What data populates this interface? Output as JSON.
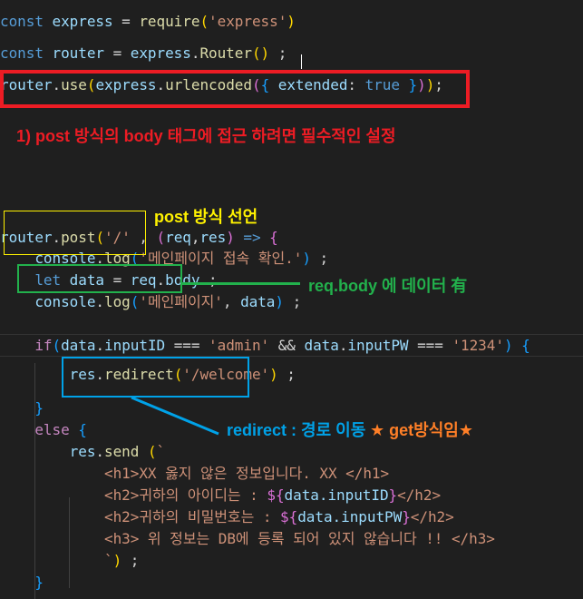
{
  "code_lines": [
    {
      "tokens": [
        [
          "const ",
          "kw"
        ],
        [
          "express",
          "var"
        ],
        [
          " = ",
          "pl"
        ],
        [
          "require",
          "fn"
        ],
        [
          "(",
          "b1"
        ],
        [
          "'express'",
          "str"
        ],
        [
          ")",
          "b1"
        ]
      ]
    },
    {
      "tokens": [
        [
          "const ",
          "kw"
        ],
        [
          "router",
          "var"
        ],
        [
          " = ",
          "pl"
        ],
        [
          "express",
          "var"
        ],
        [
          ".",
          "pl"
        ],
        [
          "Router",
          "fn"
        ],
        [
          "()",
          "b1"
        ],
        [
          " ;",
          "pl"
        ]
      ]
    },
    {
      "tokens": [
        [
          "router",
          "var"
        ],
        [
          ".",
          "pl"
        ],
        [
          "use",
          "fn"
        ],
        [
          "(",
          "b1"
        ],
        [
          "express",
          "var"
        ],
        [
          ".",
          "pl"
        ],
        [
          "urlencoded",
          "fn"
        ],
        [
          "(",
          "b2"
        ],
        [
          "{",
          "b3"
        ],
        [
          " extended",
          "var"
        ],
        [
          ": ",
          "pl"
        ],
        [
          "true",
          "kw"
        ],
        [
          " ",
          "pl"
        ],
        [
          "}",
          "b3"
        ],
        [
          ")",
          "b2"
        ],
        [
          ")",
          "b1"
        ],
        [
          ";",
          "pl"
        ]
      ]
    },
    {
      "tokens": [
        [
          "router",
          "var"
        ],
        [
          ".",
          "pl"
        ],
        [
          "post",
          "fn"
        ],
        [
          "(",
          "b1"
        ],
        [
          "'/'",
          "str"
        ],
        [
          " , ",
          "pl"
        ],
        [
          "(",
          "b2"
        ],
        [
          "req",
          "var"
        ],
        [
          ",",
          "pl"
        ],
        [
          "res",
          "var"
        ],
        [
          ")",
          "b2"
        ],
        [
          " ",
          "pl"
        ],
        [
          "=>",
          "kw"
        ],
        [
          " ",
          "pl"
        ],
        [
          "{",
          "b2"
        ]
      ]
    },
    {
      "tokens": [
        [
          "    console",
          "var"
        ],
        [
          ".",
          "pl"
        ],
        [
          "log",
          "fn"
        ],
        [
          "(",
          "b3"
        ],
        [
          "'메인페이지 접속 확인.'",
          "str"
        ],
        [
          ")",
          "b3"
        ],
        [
          " ;",
          "pl"
        ]
      ]
    },
    {
      "tokens": [
        [
          "    let ",
          "kw"
        ],
        [
          "data",
          "var"
        ],
        [
          " = ",
          "pl"
        ],
        [
          "req",
          "var"
        ],
        [
          ".",
          "pl"
        ],
        [
          "body",
          "var"
        ],
        [
          " ;",
          "pl"
        ]
      ]
    },
    {
      "tokens": [
        [
          "    console",
          "var"
        ],
        [
          ".",
          "pl"
        ],
        [
          "log",
          "fn"
        ],
        [
          "(",
          "b3"
        ],
        [
          "'메인페이지'",
          "str"
        ],
        [
          ", ",
          "pl"
        ],
        [
          "data",
          "var"
        ],
        [
          ")",
          "b3"
        ],
        [
          " ;",
          "pl"
        ]
      ]
    },
    {
      "tokens": []
    },
    {
      "tokens": [
        [
          "    if",
          "ctl"
        ],
        [
          "(",
          "b3"
        ],
        [
          "data",
          "var"
        ],
        [
          ".",
          "pl"
        ],
        [
          "inputID",
          "var"
        ],
        [
          " === ",
          "pl"
        ],
        [
          "'admin'",
          "str"
        ],
        [
          " && ",
          "pl"
        ],
        [
          "data",
          "var"
        ],
        [
          ".",
          "pl"
        ],
        [
          "inputPW",
          "var"
        ],
        [
          " === ",
          "pl"
        ],
        [
          "'1234'",
          "str"
        ],
        [
          ")",
          "b3"
        ],
        [
          " ",
          "pl"
        ],
        [
          "{",
          "b3"
        ]
      ]
    },
    {
      "tokens": [
        [
          "        res",
          "var"
        ],
        [
          ".",
          "pl"
        ],
        [
          "redirect",
          "fn"
        ],
        [
          "(",
          "b1"
        ],
        [
          "'/welcome'",
          "str"
        ],
        [
          ")",
          "b1"
        ],
        [
          " ;",
          "pl"
        ]
      ]
    },
    {
      "tokens": [
        [
          "    }",
          "b3"
        ]
      ]
    },
    {
      "tokens": [
        [
          "    else",
          "ctl"
        ],
        [
          " ",
          "pl"
        ],
        [
          "{",
          "b3"
        ]
      ]
    },
    {
      "tokens": [
        [
          "        res",
          "var"
        ],
        [
          ".",
          "pl"
        ],
        [
          "send",
          "fn"
        ],
        [
          " ",
          "pl"
        ],
        [
          "(",
          "b1"
        ],
        [
          "`",
          "str"
        ]
      ]
    },
    {
      "tokens": [
        [
          "            <h1>XX 옳지 않은 정보입니다. XX </h1>",
          "str"
        ]
      ]
    },
    {
      "tokens": [
        [
          "            <h2>귀하의 아이디는 : ",
          "str"
        ],
        [
          "${",
          "b2"
        ],
        [
          "data.inputID",
          "var"
        ],
        [
          "}",
          "b2"
        ],
        [
          "</h2>",
          "str"
        ]
      ]
    },
    {
      "tokens": [
        [
          "            <h2>귀하의 비밀번호는 : ",
          "str"
        ],
        [
          "${",
          "b2"
        ],
        [
          "data.inputPW",
          "var"
        ],
        [
          "}",
          "b2"
        ],
        [
          "</h2>",
          "str"
        ]
      ]
    },
    {
      "tokens": [
        [
          "            <h3> 위 정보는 DB에 등록 되어 있지 않습니다 !! </h3>",
          "str"
        ]
      ]
    },
    {
      "tokens": [
        [
          "            `",
          "str"
        ],
        [
          ")",
          "b1"
        ],
        [
          " ;",
          "pl"
        ]
      ]
    },
    {
      "tokens": [
        [
          "    }",
          "b3"
        ]
      ]
    }
  ],
  "annotations": {
    "urlencoded_note": "1) post 방식의 body 태그에 접근 하려면 필수적인 설정",
    "post_note": "post 방식 선언",
    "body_note": "req.body 에 데이터 有",
    "redirect_note": "redirect : 경로 이동",
    "get_note": "★ get방식임★"
  },
  "colors": {
    "red": "#ed1c24",
    "yellow": "#fff200",
    "green": "#22b14c",
    "blue": "#00a2e8",
    "orange": "#ff7f27"
  }
}
